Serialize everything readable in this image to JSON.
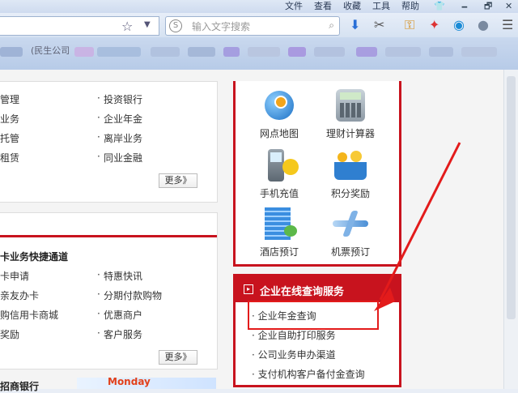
{
  "menubar": {
    "items": [
      "文件",
      "查看",
      "收藏",
      "工具",
      "帮助"
    ],
    "window_buttons": [
      "🗕",
      "🗗",
      "✕"
    ]
  },
  "toolbar": {
    "search_placeholder": "输入文字搜索",
    "search_logo": "S"
  },
  "bookmarks": {
    "partial_label": "(民生公司"
  },
  "left_top": {
    "col1": [
      "管理",
      "业务",
      "托管",
      "租赁"
    ],
    "col2": [
      "投资银行",
      "企业年金",
      "离岸业务",
      "同业金融"
    ],
    "more": "更多》"
  },
  "left_mid": {
    "title": "卡业务快捷通道",
    "col1": [
      "卡申请",
      "亲友办卡",
      "购信用卡商城",
      "奖励"
    ],
    "col2": [
      "特惠快讯",
      "分期付款购物",
      "优惠商户",
      "客户服务"
    ],
    "more": "更多》"
  },
  "left_bottom": {
    "title": "招商银行"
  },
  "banner": {
    "text": "Monday"
  },
  "services": [
    {
      "label": "网点地图",
      "icon": "globe-location-icon"
    },
    {
      "label": "理财计算器",
      "icon": "calculator-icon"
    },
    {
      "label": "手机充值",
      "icon": "mobile-phone-icon"
    },
    {
      "label": "积分奖励",
      "icon": "basket-icon"
    },
    {
      "label": "酒店预订",
      "icon": "hotel-icon"
    },
    {
      "label": "机票预订",
      "icon": "airplane-icon"
    }
  ],
  "query_panel": {
    "title": "企业在线查询服务",
    "items": [
      "企业年金查询",
      "企业自助打印服务",
      "公司业务申办渠道",
      "支付机构客户备付金查询"
    ]
  },
  "colors": {
    "brand_red": "#c8131e",
    "annotation_red": "#e31b1b"
  }
}
